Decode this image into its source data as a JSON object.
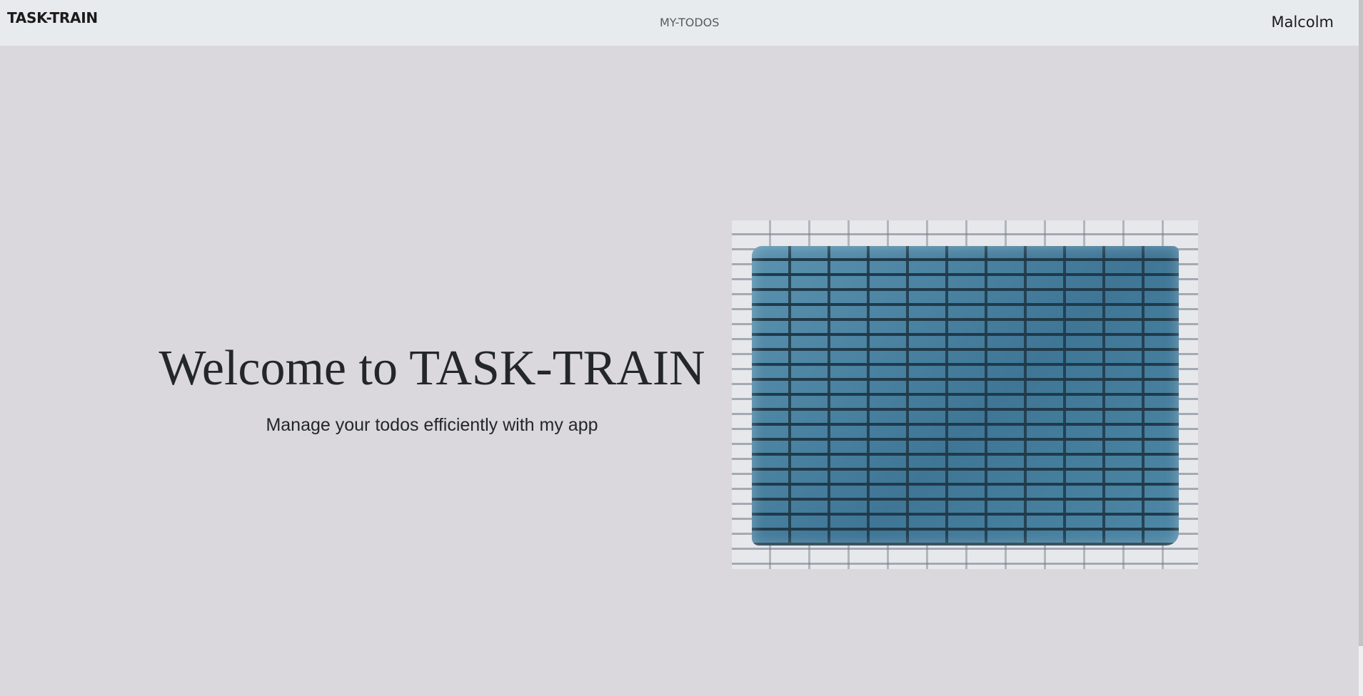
{
  "navbar": {
    "brand": "TASK-TRAIN",
    "links": [
      {
        "label": "MY-TODOS"
      }
    ],
    "user": "Malcolm"
  },
  "hero": {
    "title": "Welcome to TASK-TRAIN",
    "subtitle": "Manage your todos efficiently with my app",
    "image": {
      "subject": "blue painted brick wall"
    }
  },
  "colors": {
    "page_background": "#dad8dc",
    "navbar_background": "#e8ebee",
    "text": "#23262a",
    "paint_blue": "#4a84a2"
  }
}
